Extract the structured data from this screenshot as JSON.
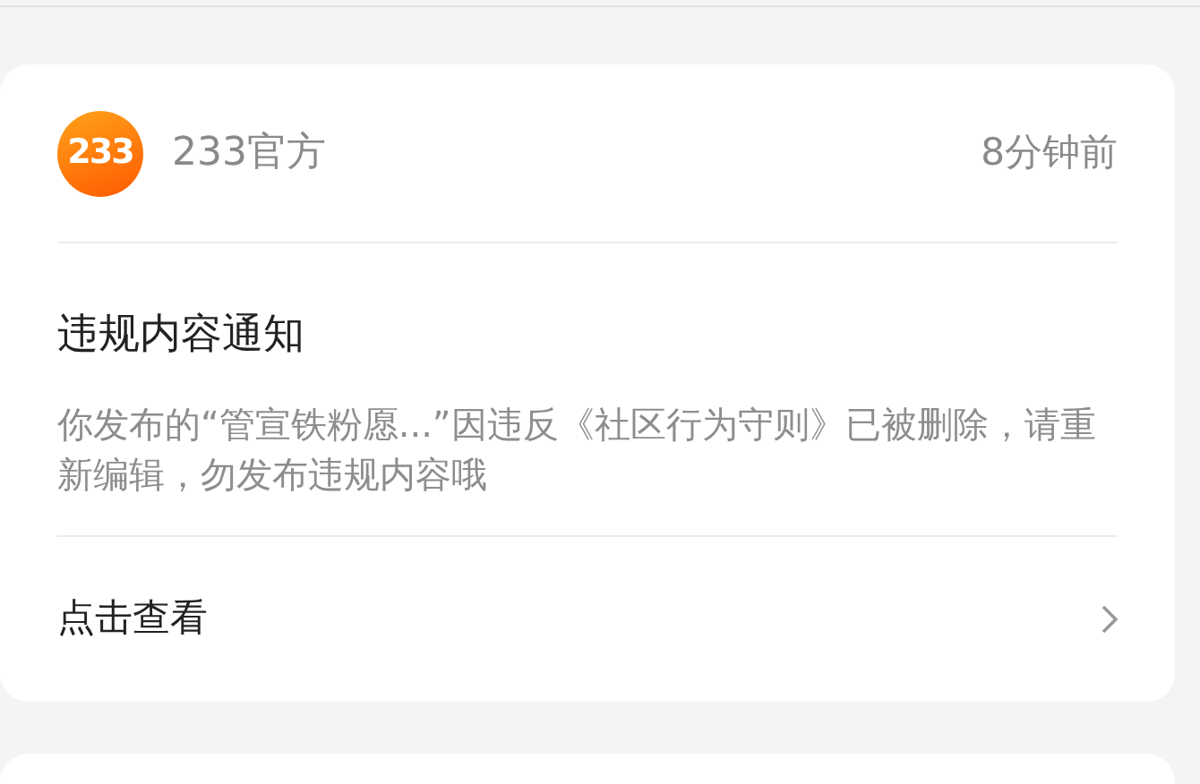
{
  "notice": {
    "avatar_text": "233",
    "sender": "233官方",
    "time": "8分钟前",
    "title": "违规内容通知",
    "body": "你发布的“管宣铁粉愿...”因违反《社区行为守则》已被删除，请重新编辑，勿发布违规内容哦",
    "action": "点击查看"
  }
}
